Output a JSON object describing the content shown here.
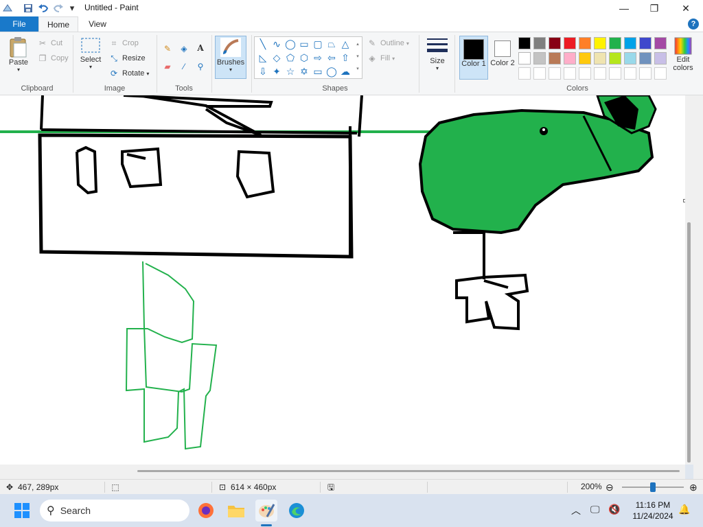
{
  "window": {
    "title": "Untitled - Paint",
    "minimize_glyph": "—",
    "maximize_glyph": "❐",
    "close_glyph": "✕"
  },
  "menu_tabs": {
    "file": "File",
    "home": "Home",
    "view": "View",
    "help": "?"
  },
  "clipboard": {
    "paste": "Paste",
    "cut": "Cut",
    "copy": "Copy",
    "label": "Clipboard"
  },
  "image": {
    "select": "Select",
    "crop": "Crop",
    "resize": "Resize",
    "rotate": "Rotate",
    "label": "Image"
  },
  "tools": {
    "label": "Tools"
  },
  "brushes": {
    "label": "Brushes"
  },
  "shapes": {
    "outline": "Outline",
    "fill": "Fill",
    "label": "Shapes"
  },
  "size": {
    "label": "Size"
  },
  "colors_group": {
    "color1_label": "Color 1",
    "color2_label": "Color 2",
    "edit_colors_label": "Edit colors",
    "label": "Colors",
    "color1": "#000000",
    "color2": "#ffffff",
    "palette_row1": [
      "#000000",
      "#7f7f7f",
      "#880015",
      "#ed1c24",
      "#ff7f27",
      "#fff200",
      "#22b14c",
      "#00a2e8",
      "#3f48cc",
      "#a349a4"
    ],
    "palette_row2": [
      "#ffffff",
      "#c3c3c3",
      "#b97a57",
      "#ffaec9",
      "#ffc90e",
      "#efe4b0",
      "#b5e61d",
      "#99d9ea",
      "#7092be",
      "#c8bfe7"
    ],
    "palette_row3": [
      "#ffffff",
      "#ffffff",
      "#ffffff",
      "#ffffff",
      "#ffffff",
      "#ffffff",
      "#ffffff",
      "#ffffff",
      "#ffffff",
      "#ffffff"
    ]
  },
  "canvas": {
    "accent_green": "#22b14c",
    "stroke": "#000000"
  },
  "status": {
    "cursor_pos": "467, 289px",
    "canvas_size": "614 × 460px",
    "zoom": "200%",
    "zoom_level_fraction": 0.5
  },
  "taskbar": {
    "search_placeholder": "Search",
    "time": "11:16 PM",
    "date": "11/24/2024"
  }
}
